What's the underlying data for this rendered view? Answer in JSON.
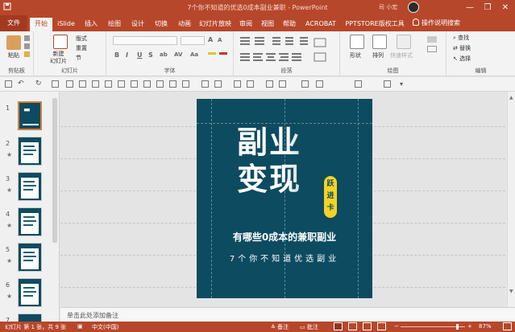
{
  "window": {
    "title": "7个你不知道的优选0成本副业兼职 - PowerPoint",
    "user": "司 小宏",
    "controls": [
      "—",
      "❐",
      "✕"
    ]
  },
  "tabs": [
    "文件",
    "开始",
    "iSlide",
    "插入",
    "绘图",
    "设计",
    "切换",
    "动画",
    "幻灯片放映",
    "审阅",
    "视图",
    "帮助",
    "ACROBAT",
    "PPTSTORE版权工具"
  ],
  "active_tab": "开始",
  "tell_me": "操作说明搜索",
  "ribbon": {
    "clipboard": {
      "label": "剪贴板",
      "paste": "粘贴"
    },
    "slides": {
      "label": "幻灯片",
      "new_slide": "新建\n幻灯片",
      "layout": "版式",
      "reset": "重置",
      "section": "节"
    },
    "font": {
      "label": "字体",
      "buttons": [
        "B",
        "I",
        "U",
        "S",
        "ab",
        "AV",
        "Aa"
      ]
    },
    "paragraph": {
      "label": "段落"
    },
    "drawing": {
      "label": "绘图",
      "shape": "形状",
      "arrange": "排列",
      "quick_styles": "快速样式"
    },
    "editing": {
      "label": "编辑",
      "find": "查找",
      "replace": "替换",
      "select": "选择"
    }
  },
  "slides_pane": {
    "thumbnails": [
      {
        "number": "1",
        "star": ""
      },
      {
        "number": "2",
        "star": "★"
      },
      {
        "number": "3",
        "star": "★"
      },
      {
        "number": "4",
        "star": "★"
      },
      {
        "number": "5",
        "star": "★"
      },
      {
        "number": "6",
        "star": "★"
      },
      {
        "number": "7",
        "star": "★"
      }
    ]
  },
  "slide": {
    "title_line1": "副业",
    "title_line2": "变现",
    "badge": "跃\n进\n卡",
    "subtitle": "有哪些0成本的兼职副业",
    "tagline": "7个你不知道优选副业"
  },
  "notes_placeholder": "单击此处添加备注",
  "status": {
    "slide_info": "幻灯片 第 1 张，共 9 张",
    "language": "中文(中国)",
    "notes_btn": "备注",
    "comments_btn": "批注",
    "zoom": "87%"
  },
  "colors": {
    "accent": "#b7472a",
    "slide_bg": "#0d4b60",
    "badge": "#f3d326"
  }
}
